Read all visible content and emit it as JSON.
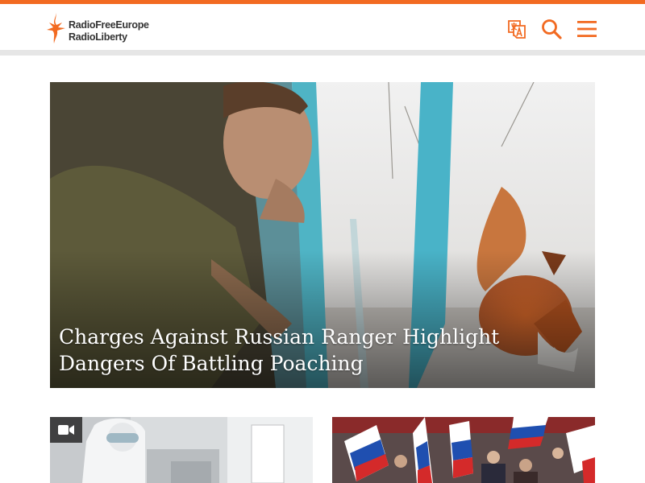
{
  "site": {
    "logo_line1": "RadioFreeEurope",
    "logo_line2": "RadioLiberty",
    "brand_color": "#f26a21"
  },
  "header": {
    "icons": [
      "language-icon",
      "search-icon",
      "menu-icon"
    ]
  },
  "hero": {
    "title": "Charges Against Russian Ranger Highlight Dangers Of Battling Poaching"
  },
  "cards": [
    {
      "media": "video",
      "badge_icon": "video-camera-icon"
    },
    {
      "media": "photo"
    }
  ]
}
